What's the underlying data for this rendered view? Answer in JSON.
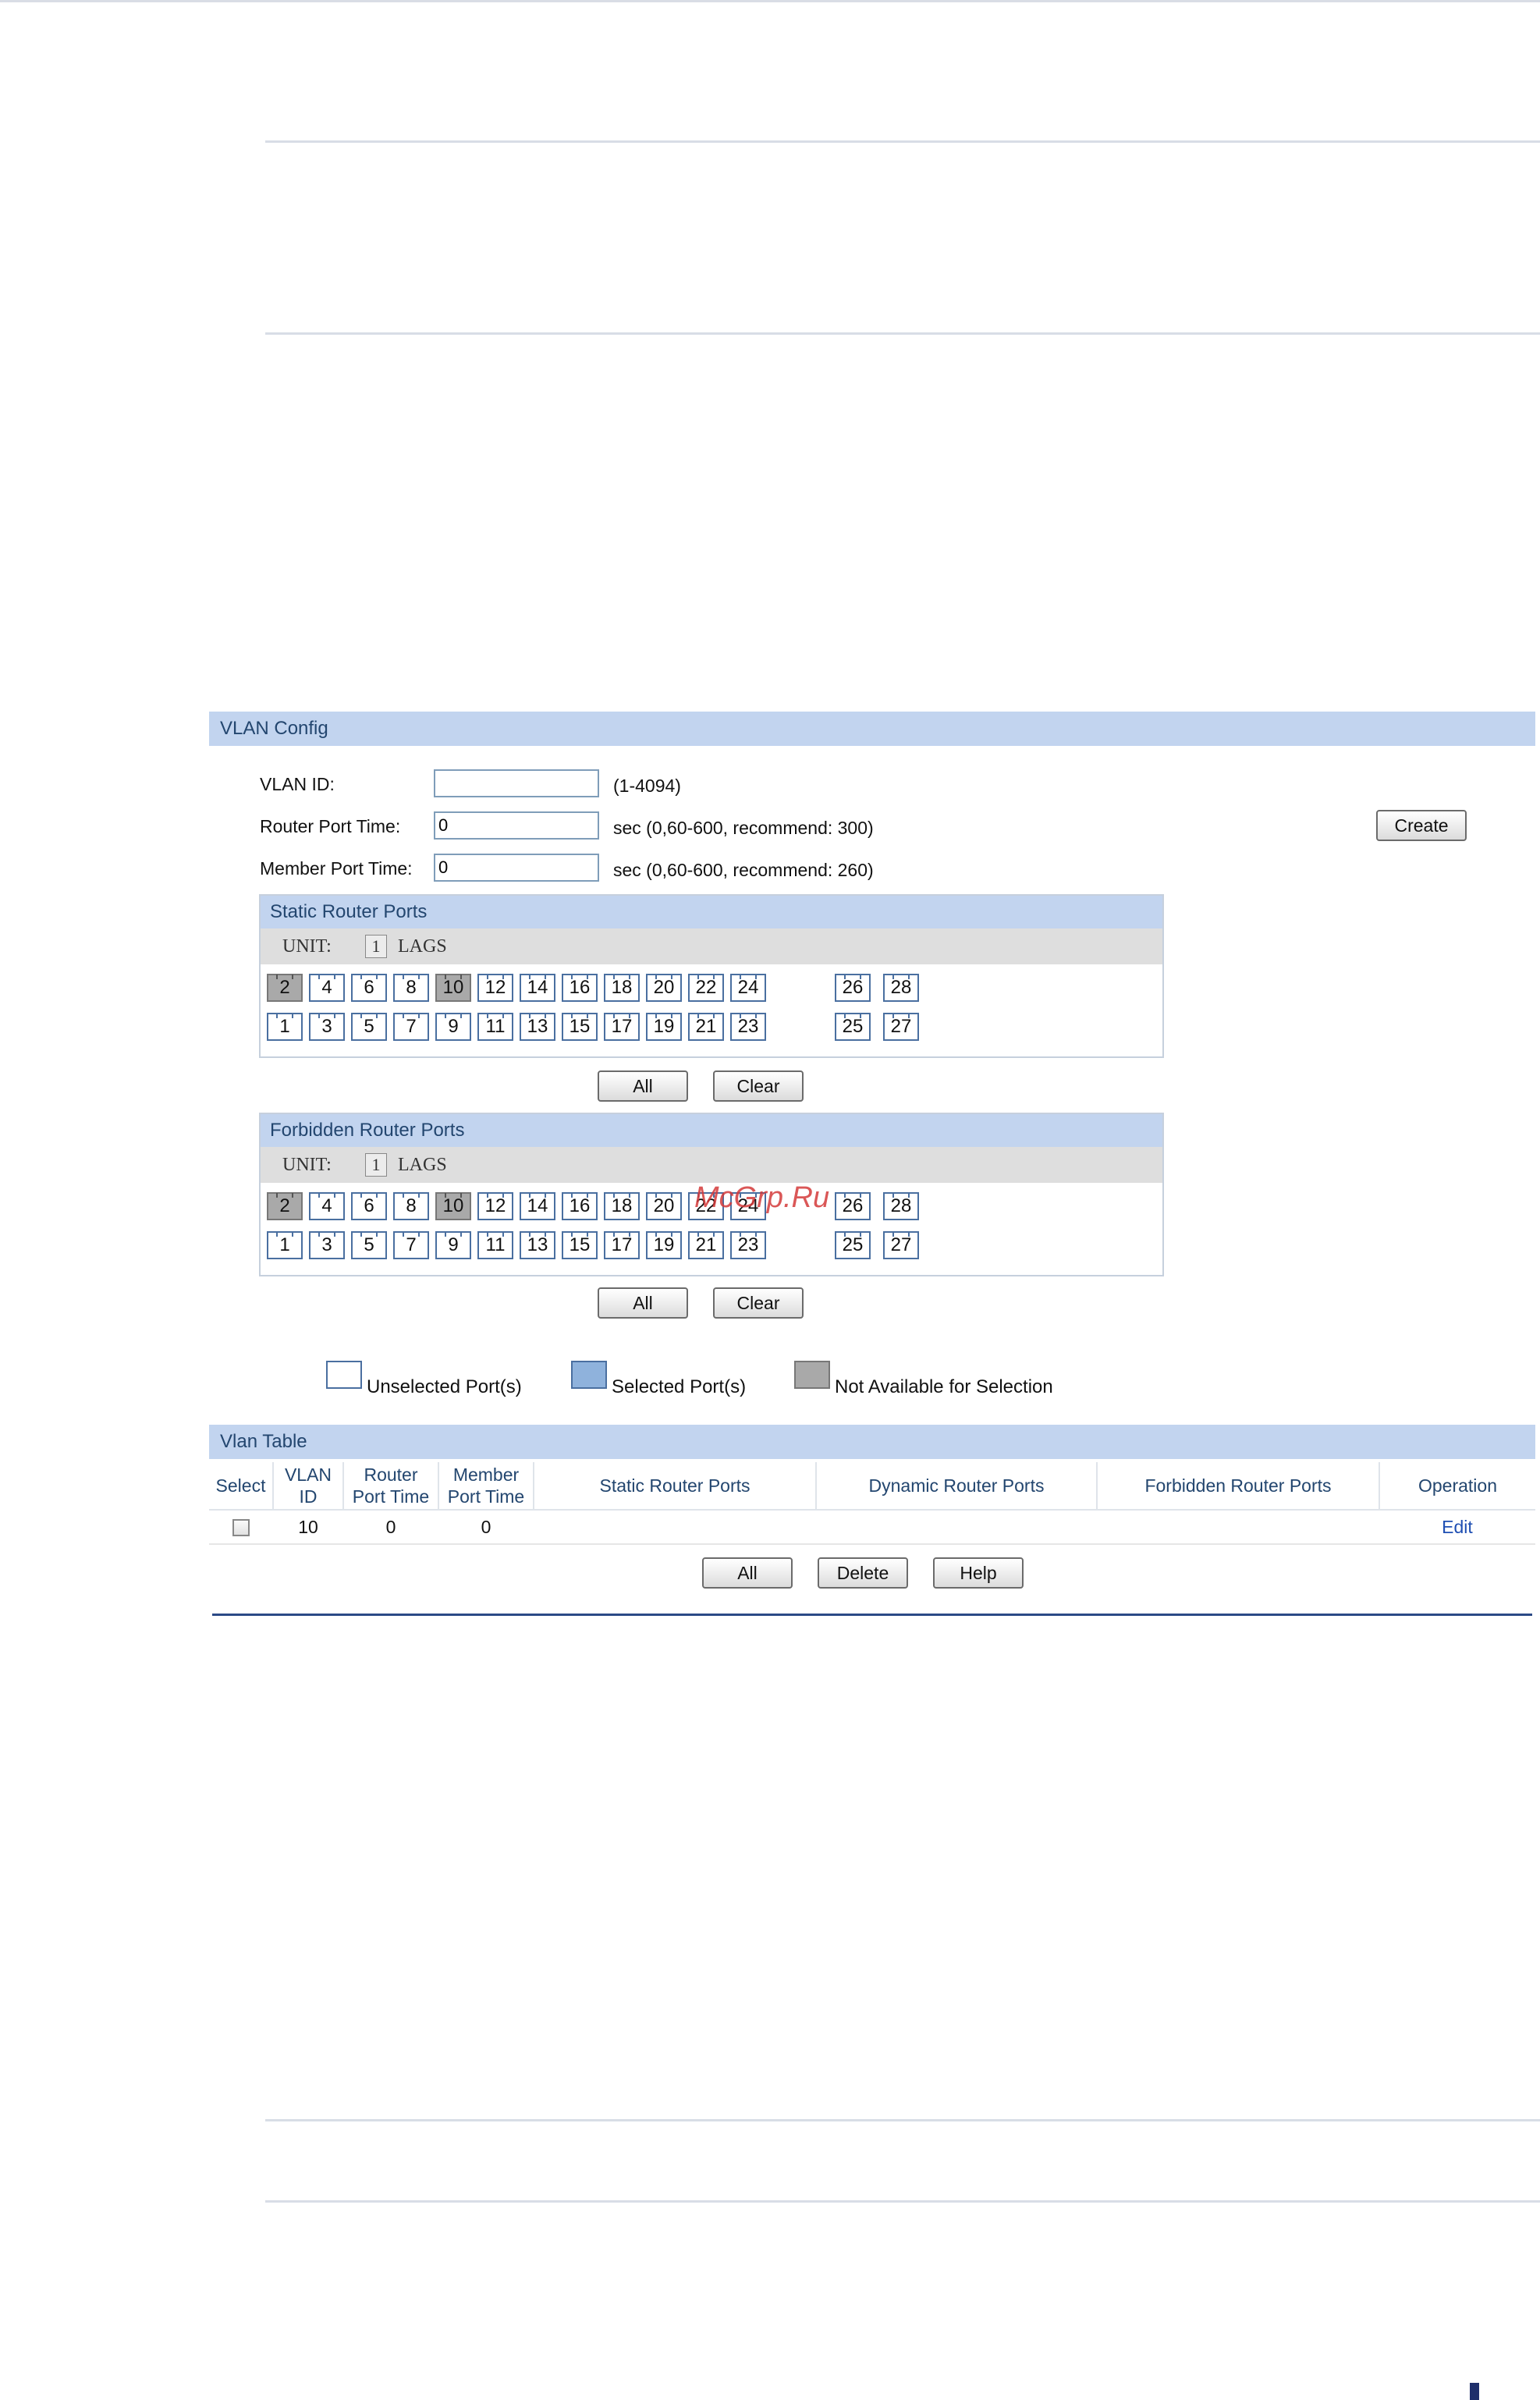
{
  "vlan_config": {
    "title": "VLAN Config",
    "vlan_id": {
      "label": "VLAN ID:",
      "value": "",
      "hint": "(1-4094)"
    },
    "router_port_time": {
      "label": "Router Port Time:",
      "value": "0",
      "hint": "sec (0,60-600, recommend: 300)"
    },
    "member_port_time": {
      "label": "Member Port Time:",
      "value": "0",
      "hint": "sec (0,60-600, recommend: 260)"
    },
    "create_button": "Create"
  },
  "static_router_ports": {
    "title": "Static Router Ports",
    "unit_label": "UNIT:",
    "unit_value": "1",
    "lags_label": "LAGS",
    "all_button": "All",
    "clear_button": "Clear"
  },
  "forbidden_router_ports": {
    "title": "Forbidden Router Ports",
    "unit_label": "UNIT:",
    "unit_value": "1",
    "lags_label": "LAGS",
    "all_button": "All",
    "clear_button": "Clear"
  },
  "ports": {
    "top_row": [
      "2",
      "4",
      "6",
      "8",
      "10",
      "12",
      "14",
      "16",
      "18",
      "20",
      "22",
      "24"
    ],
    "bottom_row": [
      "1",
      "3",
      "5",
      "7",
      "9",
      "11",
      "13",
      "15",
      "17",
      "19",
      "21",
      "23"
    ],
    "extra_top": [
      "26",
      "28"
    ],
    "extra_bottom": [
      "25",
      "27"
    ],
    "not_available": [
      "2",
      "10"
    ]
  },
  "legend": {
    "unselected": "Unselected Port(s)",
    "selected": "Selected Port(s)",
    "not_available": "Not Available for Selection"
  },
  "watermark": "McGrp.Ru",
  "vlan_table": {
    "title": "Vlan Table",
    "headers": {
      "select": "Select",
      "vlan_id": "VLAN ID",
      "router_port_time_1": "Router",
      "router_port_time_2": "Port Time",
      "member_port_time_1": "Member",
      "member_port_time_2": "Port Time",
      "static_router_ports": "Static Router Ports",
      "dynamic_router_ports": "Dynamic Router Ports",
      "forbidden_router_ports": "Forbidden Router Ports",
      "operation": "Operation"
    },
    "rows": [
      {
        "vlan_id": "10",
        "router_port_time": "0",
        "member_port_time": "0",
        "static": "",
        "dynamic": "",
        "forbidden": "",
        "operation": "Edit"
      }
    ],
    "buttons": {
      "all": "All",
      "delete": "Delete",
      "help": "Help"
    }
  },
  "colors": {
    "header_bar": "#c2d4ef",
    "header_text": "#23466f",
    "not_available_port": "#a9a9a9",
    "selected_port": "#8fb2dc"
  }
}
